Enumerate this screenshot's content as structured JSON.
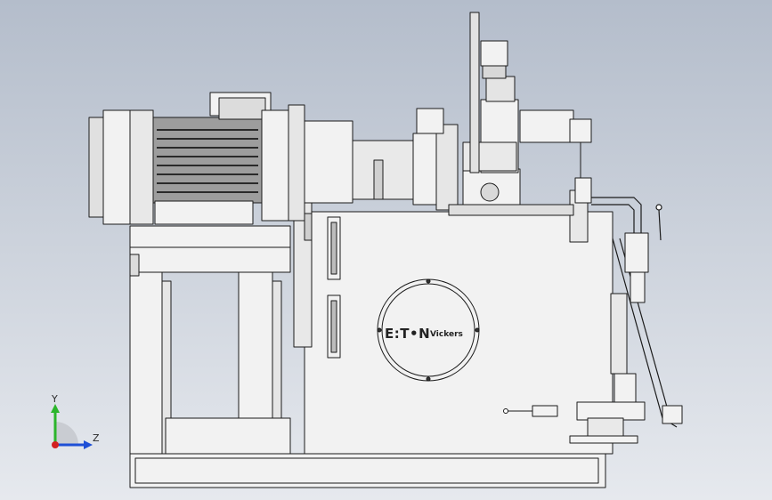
{
  "viewport": {
    "background_top": "#b4bdcb",
    "background_bottom": "#e6e9ee"
  },
  "logo": {
    "brand": "E:T•N",
    "subbrand": "Vickers"
  },
  "triad": {
    "y_label": "Y",
    "z_label": "Z",
    "y_color": "#2bb52b",
    "z_color": "#1e4fd6",
    "x_color": "#d32020"
  },
  "colors": {
    "stroke": "#1b1b1b",
    "face": "#f2f2f2",
    "shade": "#cfcfcf",
    "dark": "#3a3a3a"
  }
}
